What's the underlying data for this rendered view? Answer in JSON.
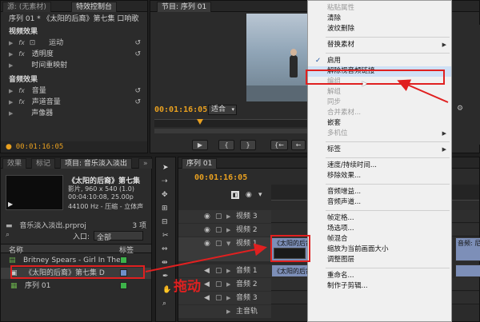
{
  "source_panel": {
    "tabs": [
      "源: (无素材)",
      "特效控制台"
    ],
    "sequence_title": "序列 01 * 《太阳的后裔》第七集 口响歌",
    "video_header": "视频效果",
    "video_effects": [
      "运动",
      "透明度",
      "时间重映射"
    ],
    "audio_header": "音频效果",
    "audio_effects": [
      "音量",
      "声道音量",
      "声像器"
    ],
    "timecode": "00:01:16:05"
  },
  "program_panel": {
    "tab": "节目: 序列 01",
    "timecode": "00:01:16:05",
    "fit_label": "适合",
    "buttons": [
      "▶",
      "{",
      "}",
      "{←",
      "←",
      "▶",
      "→|",
      "→}"
    ]
  },
  "project_panel": {
    "tabs": [
      "效果",
      "标记",
      "项目: 音乐淡入淡出",
      "»"
    ],
    "clip_title": "《太阳的后裔》第七集",
    "clip_info": [
      "影片, 960 x 540 (1.0)",
      "00:04:10:08, 25.00p",
      "44100 Hz - 压缩 - 立体声"
    ],
    "project_file": "音乐淡入淡出.prproj",
    "item_count": "3 项",
    "entry_label": "入口:",
    "entry_value": "全部",
    "columns": [
      "名称",
      "标签"
    ],
    "items": [
      {
        "name": "Britney Spears - Girl In The",
        "label_color": "#3db34a"
      },
      {
        "name": "《太阳的后裔》第七集 D",
        "label_color": "#6e8fc9"
      },
      {
        "name": "序列 01",
        "label_color": "#3db34a"
      }
    ]
  },
  "timeline_panel": {
    "tab": "序列 01",
    "timecode": "00:01:16:05",
    "tracks": [
      "视频 3",
      "视频 2",
      "视频 1",
      "音频 1",
      "音频 2",
      "音频 3",
      "主音轨"
    ],
    "clip_label": "《太阳的后裔》",
    "clip_label_right": "音频: 尼司"
  },
  "annotation": {
    "drag_text": "拖动"
  },
  "context_menu": {
    "items": [
      {
        "label": "粘贴属性",
        "enabled": false
      },
      {
        "label": "清除",
        "enabled": true
      },
      {
        "label": "波纹删除",
        "enabled": true
      },
      {
        "sep": true
      },
      {
        "label": "替换素材",
        "enabled": true,
        "submenu": true
      },
      {
        "sep": true
      },
      {
        "label": "启用",
        "enabled": true,
        "checked": true
      },
      {
        "label": "解除视音频链接",
        "enabled": true,
        "highlighted": true
      },
      {
        "label": "编组",
        "enabled": false
      },
      {
        "label": "解组",
        "enabled": false
      },
      {
        "label": "同步",
        "enabled": false
      },
      {
        "label": "合并素材...",
        "enabled": false
      },
      {
        "label": "嵌套",
        "enabled": true
      },
      {
        "label": "多机位",
        "enabled": false,
        "submenu": true
      },
      {
        "sep": true
      },
      {
        "label": "标签",
        "enabled": true,
        "submenu": true
      },
      {
        "sep": true
      },
      {
        "label": "速度/持续时间...",
        "enabled": true
      },
      {
        "label": "移除效果...",
        "enabled": true
      },
      {
        "sep": true
      },
      {
        "label": "音频增益...",
        "enabled": true
      },
      {
        "label": "音频声道...",
        "enabled": true
      },
      {
        "sep": true
      },
      {
        "label": "帧定格...",
        "enabled": true
      },
      {
        "label": "场选项...",
        "enabled": true
      },
      {
        "label": "帧混合",
        "enabled": true
      },
      {
        "label": "缩放为当前画面大小",
        "enabled": true
      },
      {
        "label": "调整图层",
        "enabled": true
      },
      {
        "sep": true
      },
      {
        "label": "重命名...",
        "enabled": true
      },
      {
        "label": "制作子剪辑...",
        "enabled": true
      }
    ]
  },
  "colors": {
    "accent_timecode": "#e8a020",
    "annotation_red": "#e02020",
    "menu_highlight_bg": "#cfe0f5"
  }
}
